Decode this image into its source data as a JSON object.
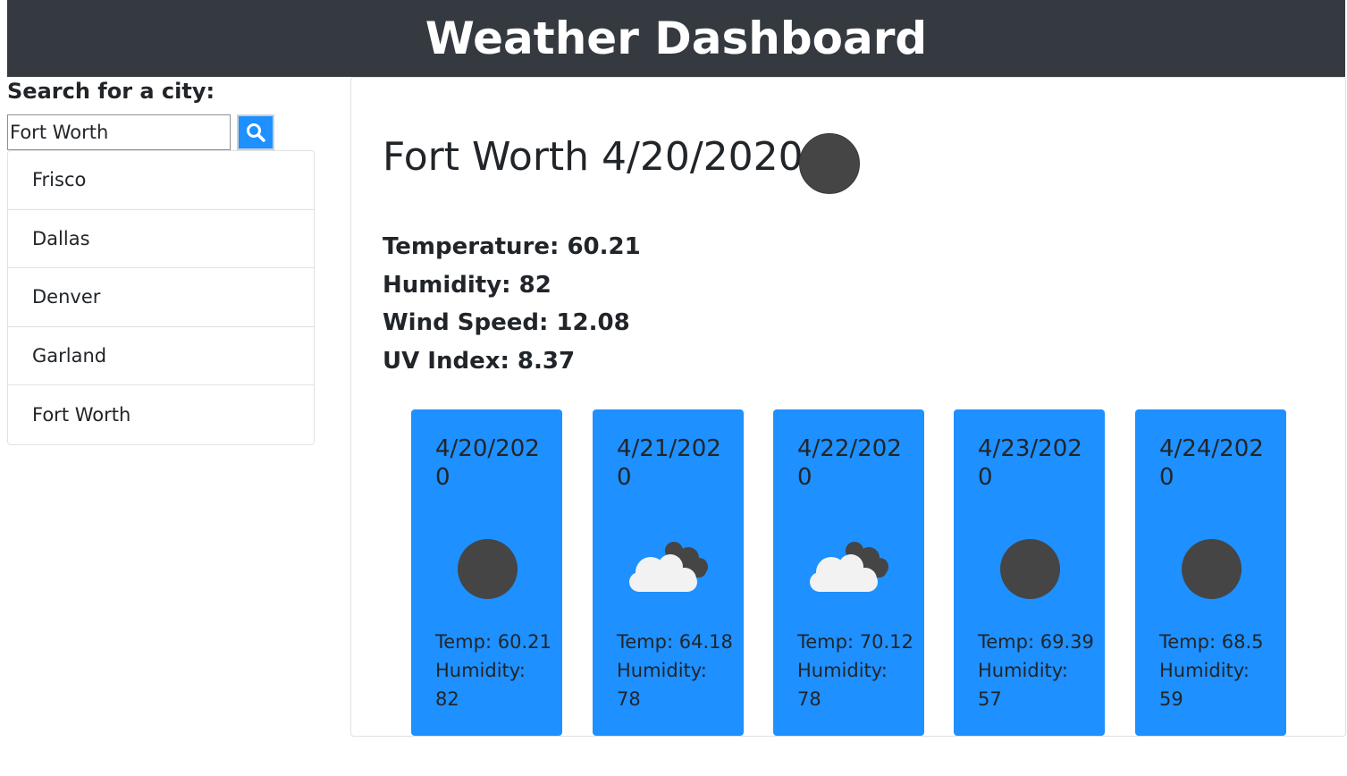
{
  "header": {
    "title": "Weather Dashboard"
  },
  "search": {
    "label": "Search for a city:",
    "value": "Fort Worth",
    "placeholder": ""
  },
  "history": {
    "items": [
      {
        "label": "Frisco"
      },
      {
        "label": "Dallas"
      },
      {
        "label": "Denver"
      },
      {
        "label": "Garland"
      },
      {
        "label": "Fort Worth"
      }
    ]
  },
  "current": {
    "title": "Fort Worth 4/20/2020",
    "icon": "clear-sky-icon",
    "temperature": "Temperature: 60.21",
    "humidity": "Humidity: 82",
    "wind": "Wind Speed: 12.08",
    "uv": "UV Index: 8.37"
  },
  "forecast": [
    {
      "date": "4/20/2020",
      "icon": "clear-sky-icon",
      "temp": "Temp: 60.21",
      "humidity_label": "Humidity:",
      "humidity_value": "82"
    },
    {
      "date": "4/21/2020",
      "icon": "cloud-icon",
      "temp": "Temp: 64.18",
      "humidity_label": "Humidity:",
      "humidity_value": "78"
    },
    {
      "date": "4/22/2020",
      "icon": "cloud-icon",
      "temp": "Temp: 70.12",
      "humidity_label": "Humidity:",
      "humidity_value": "78"
    },
    {
      "date": "4/23/2020",
      "icon": "clear-sky-icon",
      "temp": "Temp: 69.39",
      "humidity_label": "Humidity:",
      "humidity_value": "57"
    },
    {
      "date": "4/24/2020",
      "icon": "clear-sky-icon",
      "temp": "Temp: 68.5",
      "humidity_label": "Humidity:",
      "humidity_value": "59"
    }
  ],
  "colors": {
    "header_bg": "#343a40",
    "card_bg": "#1e90ff",
    "search_button_bg": "#1e90ff"
  }
}
